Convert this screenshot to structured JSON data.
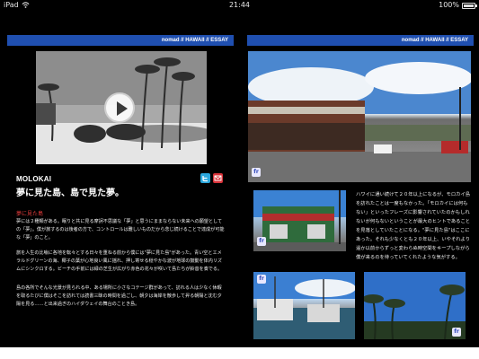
{
  "status": {
    "carrier": "iPad",
    "time": "21:44",
    "battery_percent": "100%",
    "battery_level": 1.0
  },
  "left_page": {
    "breadcrumb": "nomad // HAWAII // ESSAY",
    "location": "MOLOKAI",
    "title": "夢に見た島、島で見た夢。",
    "subhead": "夢に見た島",
    "paragraph_1": "夢には２種類がある。眠りと共に見る摩訶不思議な「夢」と思うにままならない未来への願望としての「夢」。僕が旅するのは後者の方で、コントロールは難しいものだから念じ続けることで達成が可能な「夢」のこと。",
    "paragraph_2": "旅を人生の比喩に各地を転々とする日々を重ねる前から僕には\"夢に見た島\"があった。青い空とエメラルドグリーンの海、椰子の葉が心地良い風に揺れ、押し寄せる穏やかな波が地球の鼓動を体内リズムにシンクロする。ビーチの手前には緑の芝生が広がり赤色の花々が咲いて島たちが鈴音を奏でる。",
    "paragraph_3": "島の各所でそんな光景が見られる中、ある場所に小さなコテージ群があって、訪れる人は少なく休暇を取るたびに僕はそこを訪れては読書三昧の時間を過ごし、朝夕は海岸を散歩して昇る朝陽と沈む夕陽を見る……と出来過ぎのハイダウェイの舞台のことき島。"
  },
  "right_page": {
    "breadcrumb": "nomad // HAWAII // ESSAY",
    "side_text": "ハワイに通い続けて２０年以上になるが、モロカイ島を訪れたことは一度もなかった。「モロカイには何もない」といったフレーズに影響されていたのかもしれないが何もないということが最大のヒントであることを見落としていたことになる。\"夢に見た島\"はここにあった。それも少なくとも２０年以上、いやそれより遥か以前からずっと変わらぬ時空間をキープしながら僕が来るのを待っていてくれたような気がする。",
    "badge_label": "fr"
  },
  "icons": {
    "share_twitter": "twitter-icon",
    "share_mail": "mail-icon",
    "play": "play-icon",
    "photo_badge": "flickr-badge-icon"
  },
  "colors": {
    "header_blue": "#1f4fb0",
    "subhead_red": "#e23b3b",
    "twitter_blue": "#2ba7dc",
    "mail_red": "#d9333a"
  }
}
